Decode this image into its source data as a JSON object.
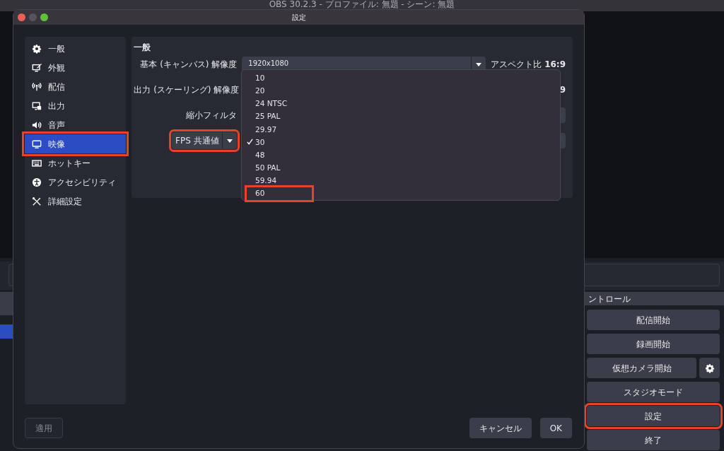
{
  "main_window": {
    "title": "OBS 30.2.3 - プロファイル: 無題 - シーン: 無題",
    "left_dock": {
      "items": [
        {
          "selected": false
        },
        {
          "selected": true
        }
      ]
    },
    "controls_dock": {
      "title": "ントロール",
      "buttons": [
        {
          "label": "配信開始",
          "highlighted": false,
          "gear": false
        },
        {
          "label": "録画開始",
          "highlighted": false,
          "gear": false
        },
        {
          "label": "仮想カメラ開始",
          "highlighted": false,
          "gear": true
        },
        {
          "label": "スタジオモード",
          "highlighted": false,
          "gear": false
        },
        {
          "label": "設定",
          "highlighted": true,
          "gear": false
        },
        {
          "label": "終了",
          "highlighted": false,
          "gear": false
        }
      ]
    }
  },
  "dialog": {
    "title": "設定",
    "sidebar": {
      "items": [
        {
          "label": "一般",
          "selected": false,
          "highlighted": false
        },
        {
          "label": "外観",
          "selected": false,
          "highlighted": false
        },
        {
          "label": "配信",
          "selected": false,
          "highlighted": false
        },
        {
          "label": "出力",
          "selected": false,
          "highlighted": false
        },
        {
          "label": "音声",
          "selected": false,
          "highlighted": false
        },
        {
          "label": "映像",
          "selected": true,
          "highlighted": true
        },
        {
          "label": "ホットキー",
          "selected": false,
          "highlighted": false
        },
        {
          "label": "アクセシビリティ",
          "selected": false,
          "highlighted": false
        },
        {
          "label": "詳細設定",
          "selected": false,
          "highlighted": false
        }
      ]
    },
    "panel": {
      "title": "一般",
      "rows": [
        {
          "kind": "label",
          "label": "基本 (キャンバス) 解像度",
          "value": "1920x1080",
          "aspect": "アスペクト比 **16:9**"
        },
        {
          "kind": "label",
          "label": "出力 (スケーリング) 解像度",
          "aspect": "**9**"
        },
        {
          "kind": "label",
          "label": "縮小フィルタ"
        },
        {
          "kind": "selector",
          "label": "FPS 共通値",
          "highlighted": true
        }
      ]
    },
    "fps_menu": {
      "items": [
        {
          "label": "10",
          "selected": false,
          "highlighted": false
        },
        {
          "label": "20",
          "selected": false,
          "highlighted": false
        },
        {
          "label": "24 NTSC",
          "selected": false,
          "highlighted": false
        },
        {
          "label": "25 PAL",
          "selected": false,
          "highlighted": false
        },
        {
          "label": "29.97",
          "selected": false,
          "highlighted": false
        },
        {
          "label": "30",
          "selected": true,
          "highlighted": false
        },
        {
          "label": "48",
          "selected": false,
          "highlighted": false
        },
        {
          "label": "50 PAL",
          "selected": false,
          "highlighted": false
        },
        {
          "label": "59.94",
          "selected": false,
          "highlighted": false
        },
        {
          "label": "60",
          "selected": false,
          "highlighted": true
        }
      ]
    },
    "buttons": [
      {
        "label": "適用",
        "disabled": true
      },
      {
        "label": "キャンセル",
        "disabled": false
      },
      {
        "label": "OK",
        "disabled": false
      }
    ]
  }
}
